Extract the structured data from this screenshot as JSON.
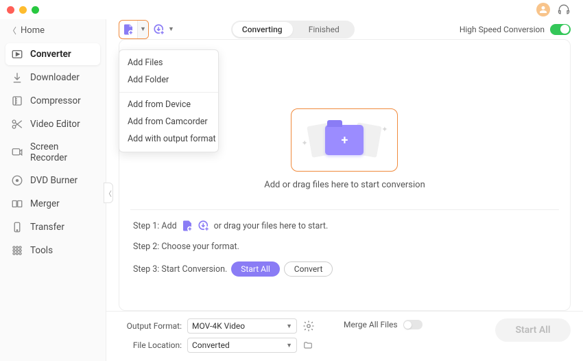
{
  "window": {
    "home": "Home"
  },
  "sidebar": {
    "items": [
      {
        "label": "Converter"
      },
      {
        "label": "Downloader"
      },
      {
        "label": "Compressor"
      },
      {
        "label": "Video Editor"
      },
      {
        "label": "Screen Recorder"
      },
      {
        "label": "DVD Burner"
      },
      {
        "label": "Merger"
      },
      {
        "label": "Transfer"
      },
      {
        "label": "Tools"
      }
    ]
  },
  "toolbar": {
    "segments": {
      "converting": "Converting",
      "finished": "Finished"
    },
    "highspeed_label": "High Speed Conversion"
  },
  "dropdown": {
    "add_files": "Add Files",
    "add_folder": "Add Folder",
    "add_device": "Add from Device",
    "add_camcorder": "Add from Camcorder",
    "add_output": "Add with output format"
  },
  "drop": {
    "hint": "Add or drag files here to start conversion"
  },
  "steps": {
    "s1_pre": "Step 1: Add",
    "s1_post": "or drag your files here to start.",
    "s2": "Step 2: Choose your format.",
    "s3_pre": "Step 3: Start Conversion.",
    "start_all": "Start  All",
    "convert": "Convert"
  },
  "bottom": {
    "output_format_label": "Output Format:",
    "output_format_value": "MOV-4K Video",
    "file_location_label": "File Location:",
    "file_location_value": "Converted",
    "merge_label": "Merge All Files",
    "start_all": "Start All"
  }
}
